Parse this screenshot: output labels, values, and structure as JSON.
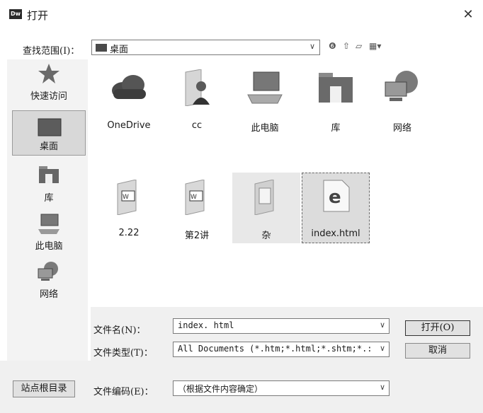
{
  "window": {
    "title": "打开",
    "app_logo": "Dw"
  },
  "look_in": {
    "label": "查找范围(I)：",
    "value": "桌面"
  },
  "sidebar": [
    {
      "label": "快速访问",
      "icon": "star-icon"
    },
    {
      "label": "桌面",
      "icon": "desktop-icon",
      "selected": true
    },
    {
      "label": "库",
      "icon": "library-icon"
    },
    {
      "label": "此电脑",
      "icon": "computer-icon"
    },
    {
      "label": "网络",
      "icon": "network-icon"
    }
  ],
  "files": [
    {
      "label": "OneDrive",
      "icon": "cloud-icon"
    },
    {
      "label": "cc",
      "icon": "user-folder-icon"
    },
    {
      "label": "此电脑",
      "icon": "computer-icon"
    },
    {
      "label": "库",
      "icon": "library-folder-icon"
    },
    {
      "label": "网络",
      "icon": "network-icon"
    },
    {
      "label": "2.22",
      "icon": "word-folder-icon"
    },
    {
      "label": "第2讲",
      "icon": "word-folder-icon"
    },
    {
      "label": "杂",
      "icon": "folder-icon"
    },
    {
      "label": "index.html",
      "icon": "edge-icon"
    }
  ],
  "filename": {
    "label": "文件名(N)：",
    "value": "index. html"
  },
  "filetype": {
    "label": "文件类型(T)：",
    "value": "All Documents (*.htm;*.html;*.shtm;*.:"
  },
  "encoding": {
    "label": "文件编码(E)：",
    "value": "（根据文件内容确定）"
  },
  "buttons": {
    "open": "打开(O)",
    "cancel": "取消",
    "site_root": "站点根目录"
  },
  "colors": {
    "sidebar_bg": "#f3f3f3",
    "bottom_bg": "#f0f0f0",
    "selected": "#d8d8d8"
  }
}
